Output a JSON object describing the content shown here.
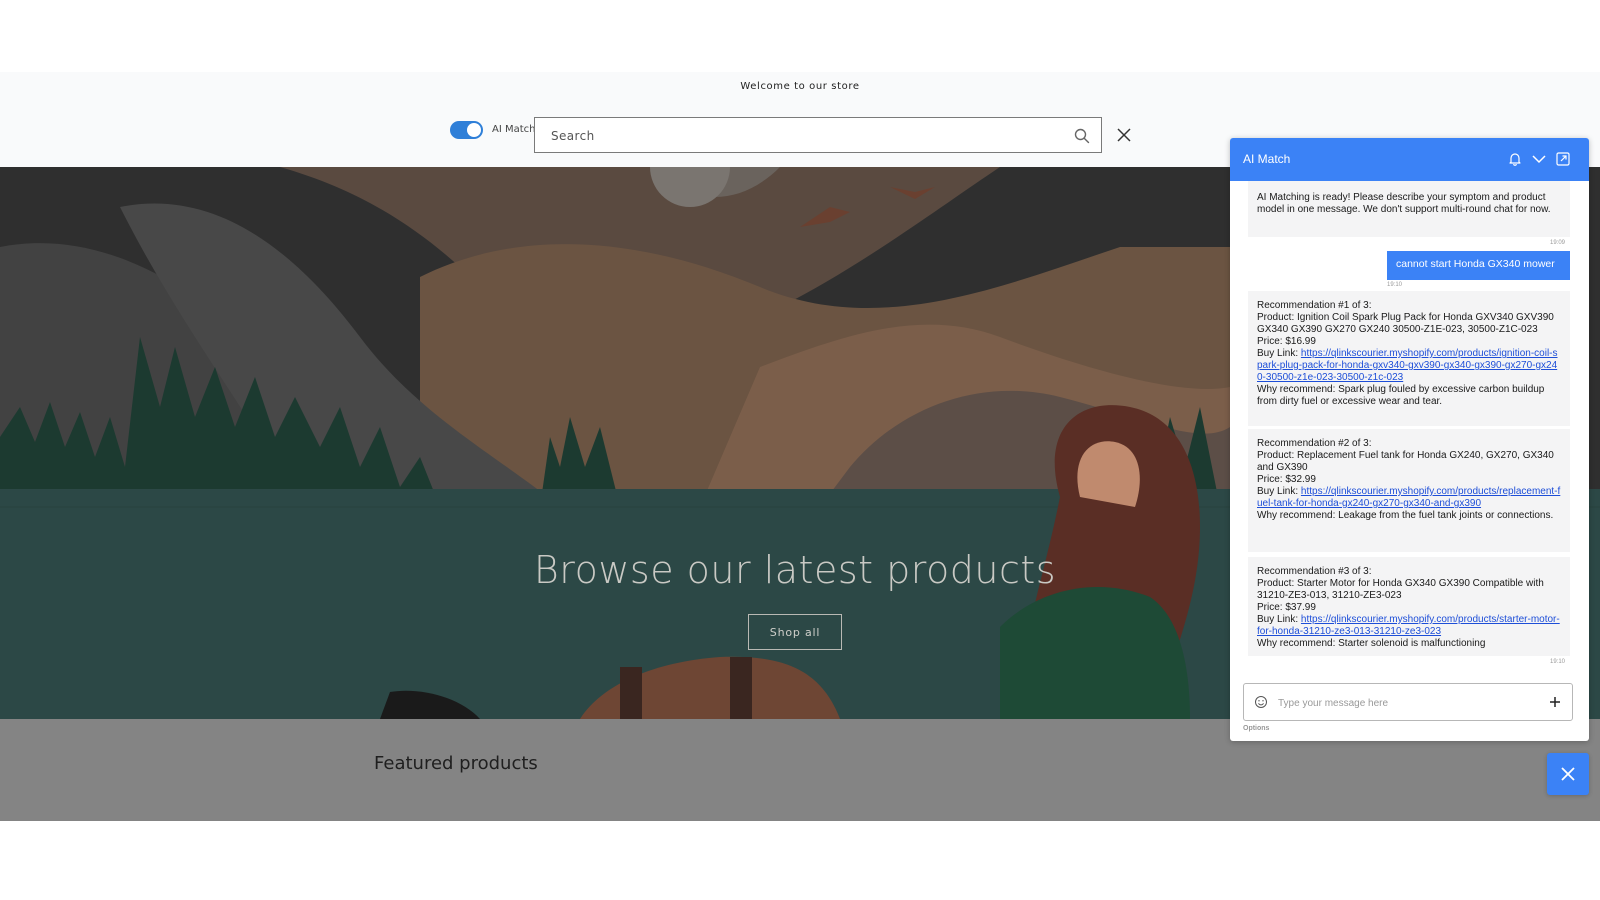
{
  "announcement": "Welcome to our store",
  "header": {
    "ai_toggle_label": "AI Match",
    "ai_toggle_on": true,
    "search_placeholder": "Search"
  },
  "hero": {
    "title": "Browse our latest products",
    "button_label": "Shop all"
  },
  "featured": {
    "title": "Featured products"
  },
  "chat": {
    "title": "AI Match",
    "icons": [
      "bell-icon",
      "chevron-down-icon",
      "external-link-icon"
    ],
    "messages": [
      {
        "role": "bot",
        "text": "AI Matching is ready! Please describe your symptom and product model in one message. We don't support multi-round chat for now.",
        "time": "19:09"
      },
      {
        "role": "user",
        "text": "cannot start Honda GX340 mower",
        "time": "19:10"
      }
    ],
    "recommendations": [
      {
        "heading": "Recommendation #1 of 3:",
        "product": "Product: Ignition Coil Spark Plug Pack for Honda GXV340 GXV390 GX340 GX390 GX270 GX240 30500-Z1E-023, 30500-Z1C-023",
        "price": "Price: $16.99",
        "link_label": "Buy Link: ",
        "link": "https://qlinkscourier.myshopify.com/products/ignition-coil-spark-plug-pack-for-honda-gxv340-gxv390-gx340-gx390-gx270-gx240-30500-z1e-023-30500-z1c-023",
        "why": "Why recommend: Spark plug fouled by excessive carbon buildup from dirty fuel or excessive wear and tear."
      },
      {
        "heading": "Recommendation #2 of 3:",
        "product": "Product: Replacement Fuel tank for Honda GX240, GX270, GX340 and GX390",
        "price": "Price: $32.99",
        "link_label": "Buy Link: ",
        "link": "https://qlinkscourier.myshopify.com/products/replacement-fuel-tank-for-honda-gx240-gx270-gx340-and-gx390",
        "why": "Why recommend: Leakage from the fuel tank joints or connections."
      },
      {
        "heading": "Recommendation #3 of 3:",
        "product": "Product: Starter Motor for Honda GX340 GX390 Compatible with 31210-ZE3-013, 31210-ZE3-023",
        "price": "Price: $37.99",
        "link_label": "Buy Link: ",
        "link": "https://qlinkscourier.myshopify.com/products/starter-motor-for-honda-31210-ze3-013-31210-ze3-023",
        "why": "Why recommend: Starter solenoid is malfunctioning"
      }
    ],
    "recommendations_time": "19:10",
    "input_placeholder": "Type your message here",
    "options_label": "Options"
  },
  "colors": {
    "accent": "#3b82f6",
    "toggle": "#2f7fd8",
    "featured_bg": "#848484"
  }
}
